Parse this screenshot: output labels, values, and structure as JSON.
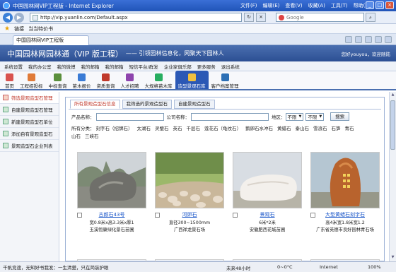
{
  "browser": {
    "window_title": "中国园林网VIP工程版 - Internet Explorer",
    "menu": [
      "文件(F)",
      "编辑(E)",
      "查看(V)",
      "收藏(A)",
      "工具(T)",
      "帮助(H)"
    ],
    "url": "http://vip.yuanlin.com/Default.aspx",
    "search_placeholder": "Google",
    "favorites": [
      "链接",
      "当当特价书"
    ],
    "tab_title": "中国园林网VIP工程版",
    "status_left": "千帆竞渡，无知好书我发：一生清楚，只在简装护眼",
    "status_mid": "未来48小时",
    "status_weather": "0~0°C",
    "status_zone": "Internet",
    "status_zoom": "100%"
  },
  "site": {
    "brand": "中国园林网园林通（VIP 版工程）",
    "slogan": "—— 引领园林信息化，网聚天下园林人",
    "welcome": "您好youyou，欢迎随陆",
    "top_nav": [
      "系统设置",
      "我的办公室",
      "我的微博",
      "我的邮箱",
      "我的邮箱",
      "短信平台/群发",
      "企业家俱乐部",
      "更多服务",
      "退出系统"
    ],
    "icon_nav": [
      {
        "label": "首页",
        "color": "#d9534f"
      },
      {
        "label": "工程招投标",
        "color": "#e07b39"
      },
      {
        "label": "中标查询",
        "color": "#5a8f3c"
      },
      {
        "label": "苗木报价",
        "color": "#3a7bd5"
      },
      {
        "label": "资质查询",
        "color": "#c0392b"
      },
      {
        "label": "人才招聘",
        "color": "#8e44ad"
      },
      {
        "label": "大规格苗木库",
        "color": "#27ae60"
      },
      {
        "label": "造型景观石库",
        "color": "#f0c040"
      },
      {
        "label": "客户档案管理",
        "color": "#2c6fb5"
      }
    ],
    "sidebar": [
      "筛选景观造型石管理",
      "自建景观造型石管理",
      "新建景观造型石单位",
      "添加自有景观造型石",
      "景观造型石企业列表"
    ],
    "content_tabs": [
      "所有景观造型石信息",
      "我筛选的景观造型石",
      "自建景观造型石"
    ],
    "search": {
      "product_label": "产品名称：",
      "company_label": "公司名称：",
      "region_label": "地区：",
      "select1": "不限",
      "select2": "不限",
      "button": "搜索"
    },
    "categories_label": "所有分类：",
    "categories": [
      "刻字石（招牌石）",
      "太湖石",
      "灵璧石",
      "英石",
      "千层石",
      "莲花石（龟纹石）",
      "鹅卵石水冲石",
      "黄蜡石",
      "泰山石",
      "雪浪石",
      "石笋",
      "青石",
      "山石",
      "三峡石"
    ],
    "products": [
      {
        "name": "古颜石43号",
        "spec": "宽0.8米x高3.3米x厚1",
        "company": "玉溪恒康绿化景石苗圃"
      },
      {
        "name": "河卵石",
        "spec": "直径300~1500mm",
        "company": "广西祥龙景石场"
      },
      {
        "name": "景观石",
        "spec": "6米*2米",
        "company": "安徽肥西花城苗圃"
      },
      {
        "name": "大型黄蜡石刻字石",
        "spec": "高4米宽1.8米宽1.2",
        "company": "广东省英德市良好园林青石场"
      }
    ]
  }
}
